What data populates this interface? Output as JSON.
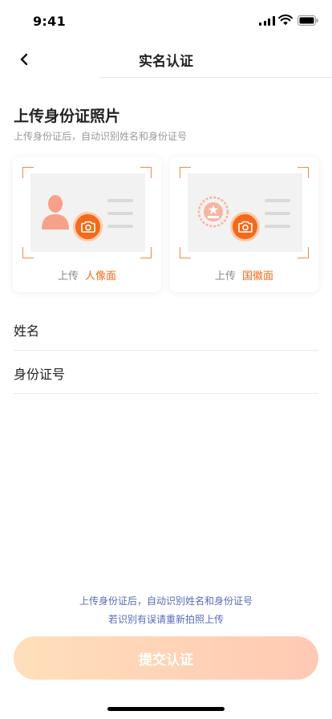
{
  "status_bar": {
    "time": "9:41",
    "icons": [
      "signal-icon",
      "wifi-icon",
      "battery-icon"
    ]
  },
  "nav": {
    "title": "实名认证",
    "back_icon": "chevron-left-icon"
  },
  "upload": {
    "title": "上传身份证照片",
    "subtitle": "上传身份证后，自动识别姓名和身份证号",
    "cards": [
      {
        "prefix": "上传",
        "side": "人像面",
        "icon": "portrait-silhouette-icon"
      },
      {
        "prefix": "上传",
        "side": "国徽面",
        "icon": "national-emblem-icon"
      }
    ],
    "camera_icon": "camera-icon"
  },
  "form": {
    "name_label": "姓名",
    "name_value": "",
    "id_label": "身份证号",
    "id_value": ""
  },
  "footer": {
    "hint_line1": "上传身份证后，自动识别姓名和身份证号",
    "hint_line2": "若识别有误请重新拍照上传",
    "submit_label": "提交认证"
  },
  "colors": {
    "accent": "#f26a1b",
    "corner": "#f08a4b",
    "hint": "#5a6bb8",
    "submit_gradient_start": "#ffdfbb",
    "submit_gradient_end": "#ffc9b3"
  }
}
